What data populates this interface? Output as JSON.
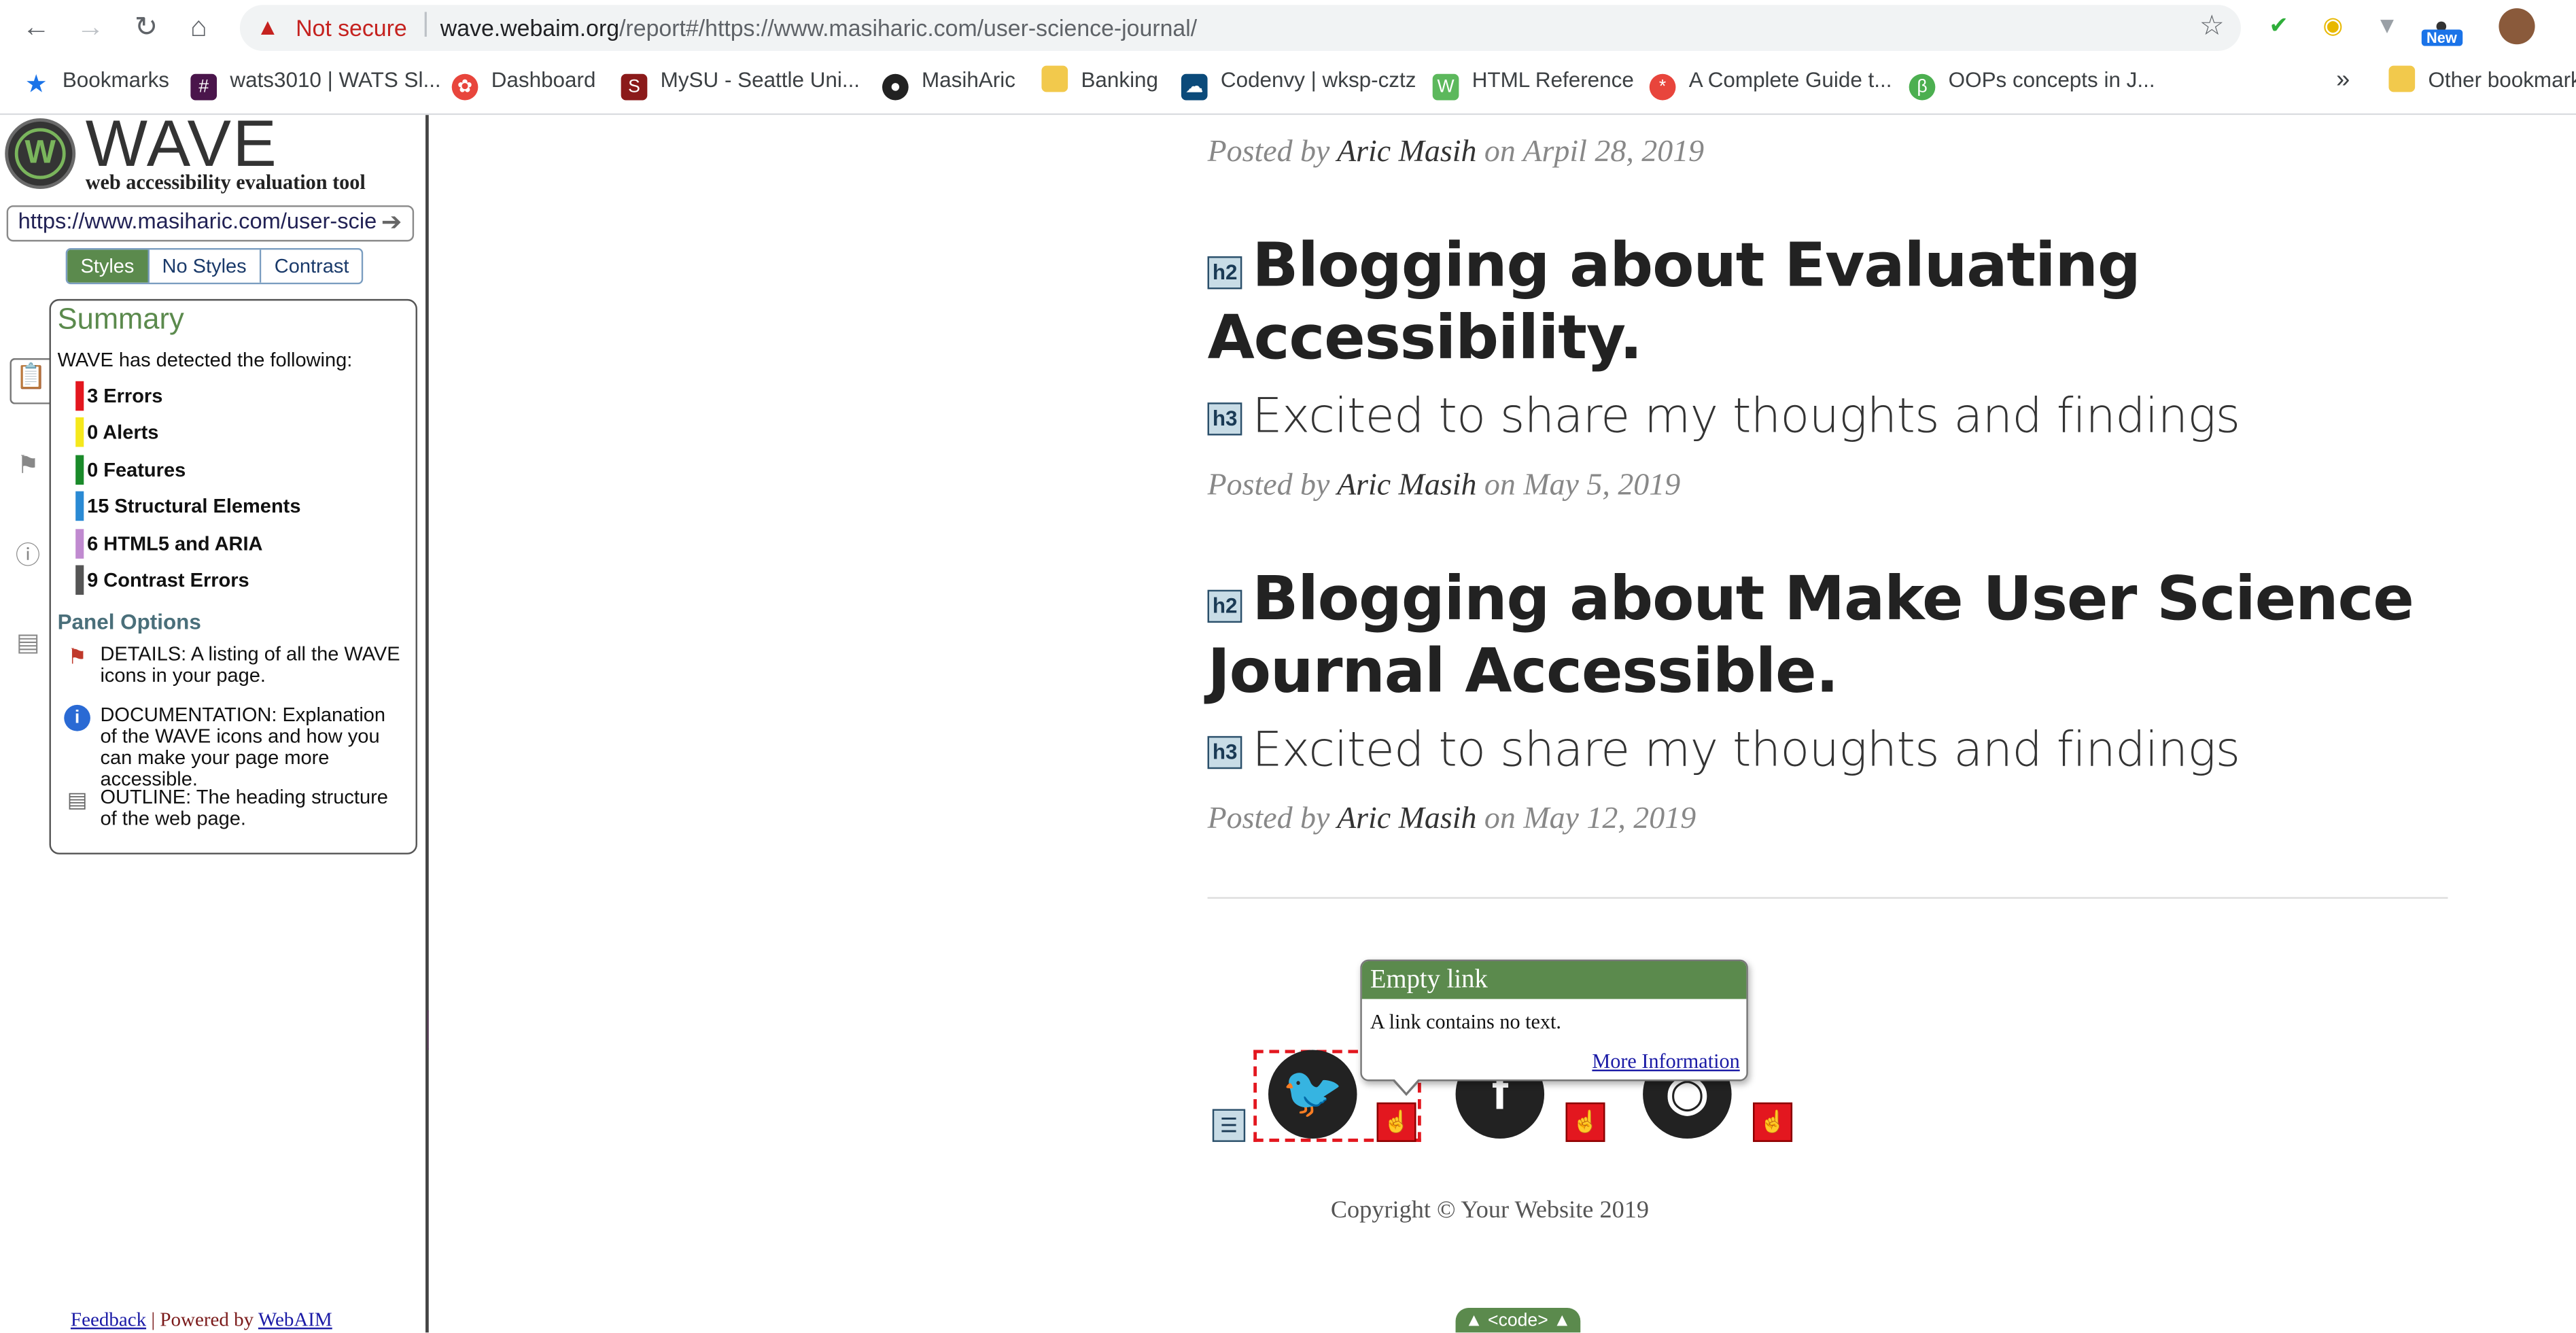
{
  "browser": {
    "nav": {
      "back": "←",
      "forward": "→",
      "reload": "↻",
      "home": "⌂"
    },
    "not_secure": "Not secure",
    "url_host": "wave.webaim.org",
    "url_path": "/report#/https://www.masiharic.com/user-science-journal/",
    "new_badge": "New",
    "bookmarks": [
      {
        "label": "Bookmarks",
        "icon": "star-icon",
        "color": "#1a73e8"
      },
      {
        "label": "wats3010 | WATS Sl...",
        "icon": "slack-icon",
        "color": "#4a154b"
      },
      {
        "label": "Dashboard",
        "icon": "dashboard-icon",
        "color": "#e8453c"
      },
      {
        "label": "MySU - Seattle Uni...",
        "icon": "su-icon",
        "color": "#8b1a1a"
      },
      {
        "label": "MasihAric",
        "icon": "github-icon",
        "color": "#222222"
      },
      {
        "label": "Banking",
        "icon": "folder-icon",
        "color": "#f2c94c"
      },
      {
        "label": "Codenvy | wksp-cztz",
        "icon": "codenvy-icon",
        "color": "#0b4a7a"
      },
      {
        "label": "HTML Reference",
        "icon": "html-icon",
        "color": "#5cb85c"
      },
      {
        "label": "A Complete Guide t...",
        "icon": "csstricks-icon",
        "color": "#e8453c"
      },
      {
        "label": "OOPs concepts in J...",
        "icon": "oops-icon",
        "color": "#4caf50"
      }
    ],
    "bookmarks_more": "»",
    "other_bookmarks": "Other bookmarks"
  },
  "wave": {
    "title": "WAVE",
    "subtitle": "web accessibility evaluation tool",
    "url_value": "https://www.masiharic.com/user-scie",
    "tabs": [
      "Styles",
      "No Styles",
      "Contrast"
    ],
    "summary_title": "Summary",
    "detected": "WAVE has detected the following:",
    "summary": [
      {
        "label": "3 Errors",
        "color": "#e3171f"
      },
      {
        "label": "0 Alerts",
        "color": "#f5e81c"
      },
      {
        "label": "0 Features",
        "color": "#1a8a2a"
      },
      {
        "label": "15 Structural Elements",
        "color": "#2a8ad4"
      },
      {
        "label": "6 HTML5 and ARIA",
        "color": "#c08ad0"
      },
      {
        "label": "9 Contrast Errors",
        "color": "#555555"
      }
    ],
    "panel_options": "Panel Options",
    "options": [
      {
        "text": "DETAILS: A listing of all the WAVE icons in your page.",
        "icon": "flag-icon"
      },
      {
        "text": "DOCUMENTATION: Explanation of the WAVE icons and how you can make your page more accessible.",
        "icon": "info-icon"
      },
      {
        "text": "OUTLINE: The heading structure of the web page.",
        "icon": "document-icon"
      }
    ],
    "footer_feedback": "Feedback",
    "footer_sep": " | Powered by ",
    "footer_webaim": "WebAIM"
  },
  "page": {
    "post0": {
      "posted_by": "Posted by ",
      "author": "Aric Masih",
      "date": " on Arpil 28, 2019"
    },
    "post1": {
      "heading": "Blogging about Evaluating Accessibility.",
      "subheading": "Excited to share my thoughts and findings",
      "posted_by": "Posted by ",
      "author": "Aric Masih",
      "date": " on May 5, 2019"
    },
    "post2": {
      "heading": "Blogging about Make User Science Journal Accessible.",
      "subheading": "Excited to share my thoughts and findings",
      "posted_by": "Posted by ",
      "author": "Aric Masih",
      "date": " on May 12, 2019"
    },
    "h2_tag": "h2",
    "h3_tag": "h3",
    "tooltip": {
      "title": "Empty link",
      "body": "A link contains no text.",
      "link": "More Information"
    },
    "copyright": "Copyright © Your Website 2019",
    "code_toggle": "▲ <code> ▲"
  }
}
